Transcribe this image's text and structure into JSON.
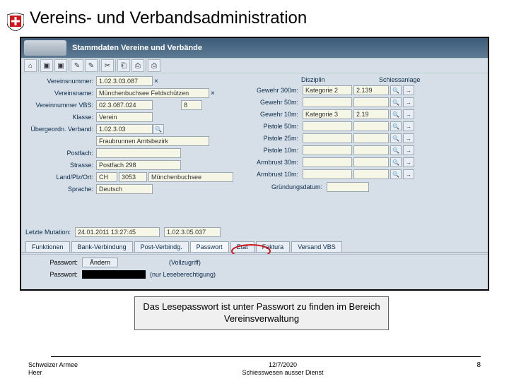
{
  "page": {
    "title": "Vereins- und Verbandsadministration"
  },
  "app": {
    "title": "Stammdaten Vereine und Verbände"
  },
  "toolbar": {
    "home": "⌂",
    "b1": "▣",
    "b2": "▣",
    "b3": "✎",
    "b4": "✎",
    "b5": "✂",
    "b6": "⎗",
    "b7": "⎙",
    "b8": "⎙"
  },
  "left": {
    "l1": "Vereinsnummer:",
    "v1": "1.02.3.03.087",
    "l2": "Vereinsname:",
    "v2": "Münchenbuchsee Feldschützen",
    "l3": "Vereinnummer VBS:",
    "v3": "02.3.087.024",
    "v3b": "8",
    "l4": "Klasse:",
    "v4": "Verein",
    "l5": "Übergeordn. Verband:",
    "v5": "1.02.3.03",
    "v5b": "Fraubrunnen Amtsbezirk",
    "l6": "Postfach:",
    "v6": "",
    "l7": "Strasse:",
    "v7": "Postfach 298",
    "l8": "Land/Plz/Ort:",
    "v8a": "CH",
    "v8b": "3053",
    "v8c": "Münchenbuchsee",
    "l9": "Sprache:",
    "v9": "Deutsch"
  },
  "disz": {
    "h1": "Disziplin",
    "h2": "Schiessanlage",
    "r": [
      {
        "lbl": "Gewehr 300m:",
        "a": "Kategorie 2",
        "b": "2.139"
      },
      {
        "lbl": "Gewehr 50m:",
        "a": "",
        "b": ""
      },
      {
        "lbl": "Gewehr 10m:",
        "a": "Kategorie 3",
        "b": "2.19"
      },
      {
        "lbl": "Pistole 50m:",
        "a": "",
        "b": ""
      },
      {
        "lbl": "Pistole 25m:",
        "a": "",
        "b": ""
      },
      {
        "lbl": "Pistole 10m:",
        "a": "",
        "b": ""
      },
      {
        "lbl": "Armbrust 30m:",
        "a": "",
        "b": ""
      },
      {
        "lbl": "Armbrust 10m:",
        "a": "",
        "b": ""
      }
    ],
    "grund": "Gründungsdatum:",
    "grund_v": ""
  },
  "lastmut": {
    "lbl": "Letzte Mutation:",
    "d": "24.01.2011 13:27:45",
    "n": "1.02.3.05.037"
  },
  "tabs": {
    "t1": "Funktionen",
    "t2": "Bank-Verbindung",
    "t3": "Post-Verbindg.",
    "t4": "Passwort",
    "t5": "Etat",
    "t6": "Faktura",
    "t7": "Versand VBS"
  },
  "pw": {
    "lbl1": "Passwort:",
    "btn": "Ändern",
    "desc1": "(Vollzugriff)",
    "lbl2": "Passwort:",
    "desc2": "(nur Leseberechtigung)"
  },
  "callout": "Das Lesepasswort ist unter Passwort zu finden im Bereich Vereinsverwaltung",
  "footer": {
    "org1": "Schweizer Armee",
    "org2": "Heer",
    "date": "12/7/2020",
    "dept": "Schiesswesen ausser Dienst",
    "page": "8"
  }
}
